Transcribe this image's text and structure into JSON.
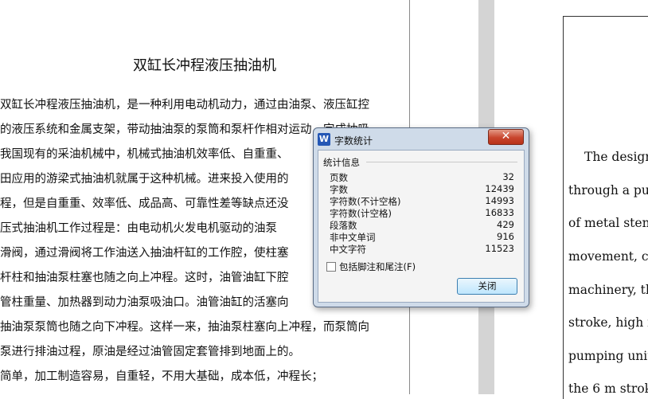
{
  "document": {
    "title": "双缸长冲程液压抽油机",
    "lines": [
      "双缸长冲程液压抽油机，是一种利用电动机动力，通过由油泵、液压缸控",
      "的液压系统和金属支架，带动抽油泵的泵筒和泵杆作相对运动，完成抽吸",
      "我国现有的采油机械中，机械式抽油机效率低、自重重、",
      "田应用的游梁式抽油机就属于这种机械。进来投入使用的",
      "程，但是自重重、效率低、成品高、可靠性差等缺点还没",
      "压式抽油机工作过程是：由电动机火发电机驱动的油泵",
      "滑阀，通过滑阀将工作油送入抽油杆缸的工作腔，使柱塞",
      "杆柱和抽油泵柱塞也随之向上冲程。这时，油管油缸下腔",
      "管柱重量、加热器到动力油泵吸油口。油管油缸的活塞向",
      "抽油泵泵筒也随之向下冲程。这样一来，抽油泵柱塞向上冲程，而泵筒向",
      "泵进行排油过程，原油是经过油管固定套管排到地面上的。",
      "简单，加工制造容易，自重轻，不用大基础，成本低，冲程长；"
    ]
  },
  "english_page": {
    "lines": [
      "The design",
      "through a pur",
      "of metal stent",
      "movement, co",
      "machinery, th",
      "stroke, high f",
      "pumping unit",
      "the 6 m strok"
    ]
  },
  "dialog": {
    "app_icon": "W",
    "title": "字数统计",
    "close_glyph": "✕",
    "group_label": "统计信息",
    "stats": [
      {
        "label": "页数",
        "value": "32"
      },
      {
        "label": "字数",
        "value": "12439"
      },
      {
        "label": "字符数(不计空格)",
        "value": "14993"
      },
      {
        "label": "字符数(计空格)",
        "value": "16833"
      },
      {
        "label": "段落数",
        "value": "429"
      },
      {
        "label": "非中文单词",
        "value": "916"
      },
      {
        "label": "中文字符",
        "value": "11523"
      }
    ],
    "checkbox_label": "包括脚注和尾注(F)",
    "ok_label": "关闭"
  }
}
